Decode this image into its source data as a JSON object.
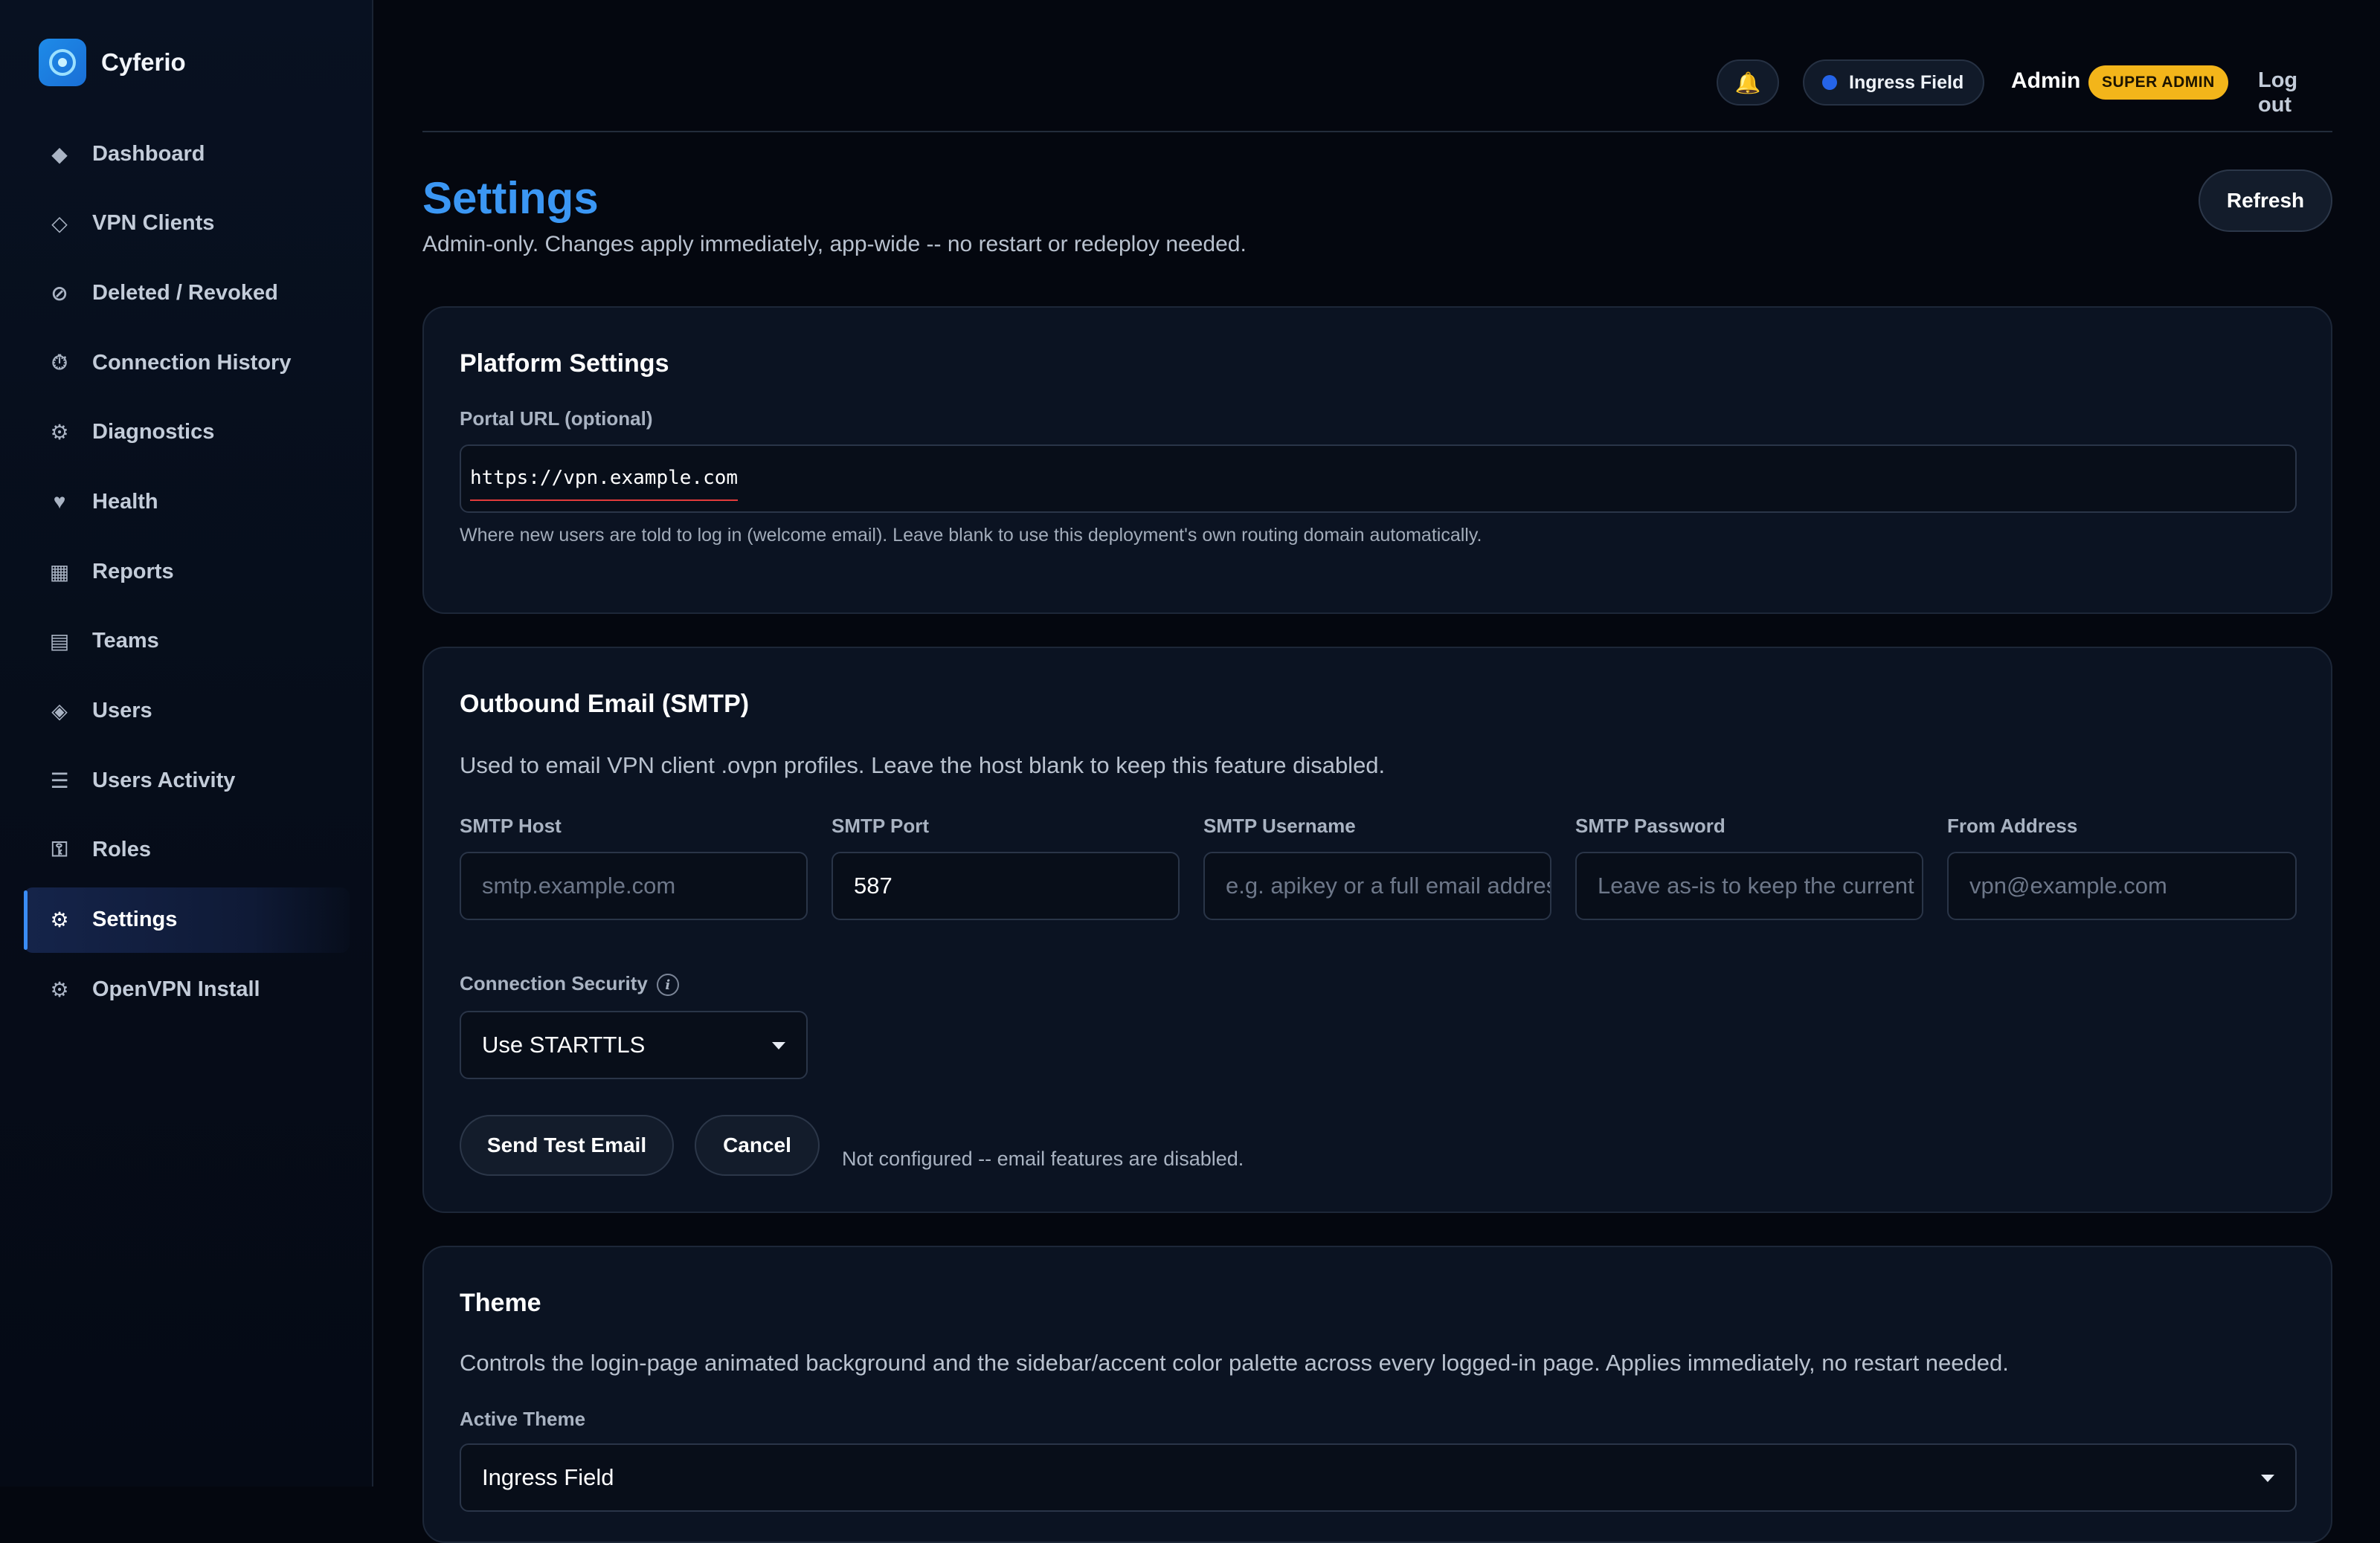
{
  "brand": {
    "name": "Cyferio",
    "logo_icon": "target-logo-icon"
  },
  "sidebar": {
    "items": [
      {
        "label": "Dashboard",
        "icon": "◆",
        "icon_name": "diamond-icon",
        "active": false
      },
      {
        "label": "VPN Clients",
        "icon": "◇",
        "icon_name": "diamond-outline-icon",
        "active": false
      },
      {
        "label": "Deleted / Revoked",
        "icon": "⊘",
        "icon_name": "revoked-icon",
        "active": false
      },
      {
        "label": "Connection History",
        "icon": "⏱",
        "icon_name": "stopwatch-icon",
        "active": false
      },
      {
        "label": "Diagnostics",
        "icon": "⚙",
        "icon_name": "gear-icon",
        "active": false
      },
      {
        "label": "Health",
        "icon": "♥",
        "icon_name": "heart-icon",
        "active": false
      },
      {
        "label": "Reports",
        "icon": "▦",
        "icon_name": "grid-icon",
        "active": false
      },
      {
        "label": "Teams",
        "icon": "▤",
        "icon_name": "list-box-icon",
        "active": false
      },
      {
        "label": "Users",
        "icon": "◈",
        "icon_name": "users-diamond-icon",
        "active": false
      },
      {
        "label": "Users Activity",
        "icon": "☰",
        "icon_name": "menu-lines-icon",
        "active": false
      },
      {
        "label": "Roles",
        "icon": "⚿",
        "icon_name": "key-icon",
        "active": false
      },
      {
        "label": "Settings",
        "icon": "⚙",
        "icon_name": "gear-icon",
        "active": true
      },
      {
        "label": "OpenVPN Install",
        "icon": "⚙",
        "icon_name": "gear-icon",
        "active": false
      }
    ]
  },
  "topbar": {
    "bell_icon": "🔔",
    "ingress_label": "Ingress Field",
    "admin_name": "Admin",
    "role_badge": "SUPER ADMIN",
    "logout_label": "Log out"
  },
  "page": {
    "title": "Settings",
    "subtitle": "Admin-only. Changes apply immediately, app-wide -- no restart or redeploy needed.",
    "refresh_label": "Refresh"
  },
  "platform": {
    "title": "Platform Settings",
    "portal_label": "Portal URL (optional)",
    "portal_value": "https://vpn.example.com",
    "portal_help": "Where new users are told to log in (welcome email). Leave blank to use this deployment's own routing domain automatically."
  },
  "smtp": {
    "title": "Outbound Email (SMTP)",
    "description": "Used to email VPN client .ovpn profiles. Leave the host blank to keep this feature disabled.",
    "host_label": "SMTP Host",
    "host_placeholder": "smtp.example.com",
    "port_label": "SMTP Port",
    "port_value": "587",
    "username_label": "SMTP Username",
    "username_placeholder": "e.g. apikey or a full email address",
    "password_label": "SMTP Password",
    "password_placeholder": "Leave as-is to keep the current password",
    "from_label": "From Address",
    "from_placeholder": "vpn@example.com",
    "security_label": "Connection Security",
    "security_value": "Use STARTTLS",
    "send_test_label": "Send Test Email",
    "cancel_label": "Cancel",
    "status_note": "Not configured -- email features are disabled."
  },
  "theme": {
    "title": "Theme",
    "description": "Controls the login-page animated background and the sidebar/accent color palette across every logged-in page. Applies immediately, no restart needed.",
    "active_label": "Active Theme",
    "active_value": "Ingress Field"
  },
  "colors": {
    "accent": "#3b97f4",
    "badge": "#f3b51a",
    "error_underline": "#e23b3b"
  }
}
